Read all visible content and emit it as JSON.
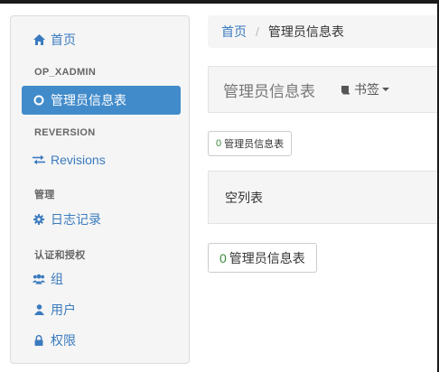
{
  "sidebar": {
    "home": "首页",
    "section1": "OP_XADMIN",
    "active_item": "管理员信息表",
    "section2": "REVERSION",
    "revisions": "Revisions",
    "section3": "管理",
    "log": "日志记录",
    "section4": "认证和授权",
    "group": "组",
    "user": "用户",
    "permission": "权限"
  },
  "breadcrumb": {
    "home": "首页",
    "separator": "/",
    "current": "管理员信息表"
  },
  "header": {
    "title": "管理员信息表",
    "bookmark": "书签"
  },
  "button_small": {
    "count": "0",
    "label": "管理员信息表"
  },
  "empty_list": "空列表",
  "button_large": {
    "count": "0",
    "label": "管理员信息表"
  },
  "colors": {
    "link": "#3a7bbf",
    "active_bg": "#428bca",
    "count_green": "#3c8a3c"
  }
}
